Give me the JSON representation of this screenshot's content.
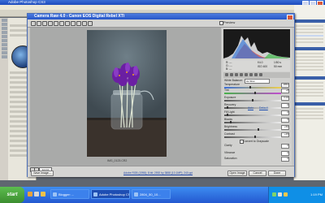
{
  "photoshop": {
    "title": "Adobe Photoshop CS3"
  },
  "dialog": {
    "title": "Camera Raw 4.0  -  Canon EOS Digital Rebel XTi",
    "preview_label": "Preview",
    "photo_filename": "IMG_0123.CR2",
    "zoom_value": "14.1%",
    "workflow_link": "Adobe RGB (1998); 8 bit; 2592 by 3888 (10.1MP); 240 ppi",
    "buttons": {
      "save": "Save Image...",
      "open": "Open Image",
      "cancel": "Cancel",
      "done": "Done"
    },
    "camera_info": {
      "aperture": "f/4.0",
      "shutter": "1/50 s",
      "iso": "ISO 400",
      "focal": "50 mm",
      "r": "R: ---",
      "g": "G: ---",
      "b": "B: ---"
    },
    "basic": {
      "white_balance_label": "White Balance:",
      "white_balance_value": "As Shot",
      "auto_link": "Auto",
      "default_link": "Default",
      "clarity_label": "Clarity",
      "clarity_value": "0",
      "vibrance_label": "Vibrance",
      "vibrance_value": "0",
      "saturation_label": "Saturation",
      "saturation_value": "0",
      "convert_label": "Convert to Grayscale",
      "sliders": [
        {
          "label": "Temperature",
          "value": "4850",
          "level": 0.45
        },
        {
          "label": "Tint",
          "value": "+8",
          "level": 0.55
        },
        {
          "label": "Exposure",
          "value": "0.00",
          "level": 0.5
        },
        {
          "label": "Recovery",
          "value": "0",
          "level": 0.05
        },
        {
          "label": "Fill Light",
          "value": "0",
          "level": 0.05
        },
        {
          "label": "Blacks",
          "value": "5",
          "level": 0.1
        },
        {
          "label": "Brightness",
          "value": "+50",
          "level": 0.6
        },
        {
          "label": "Contrast",
          "value": "+25",
          "level": 0.55
        }
      ]
    }
  },
  "taskbar": {
    "start_label": "start",
    "tasks": [
      {
        "label": "Blogger: ...",
        "active": false
      },
      {
        "label": "Adobe Photoshop CS3",
        "active": true
      },
      {
        "label": "2804_50_10...",
        "active": false
      }
    ],
    "clock": "1:19 PM"
  },
  "colors": {
    "accent": "#2756c6",
    "taskbar": "#2458d0",
    "start": "#3c8d2f",
    "flower": "#6b1fa3"
  }
}
